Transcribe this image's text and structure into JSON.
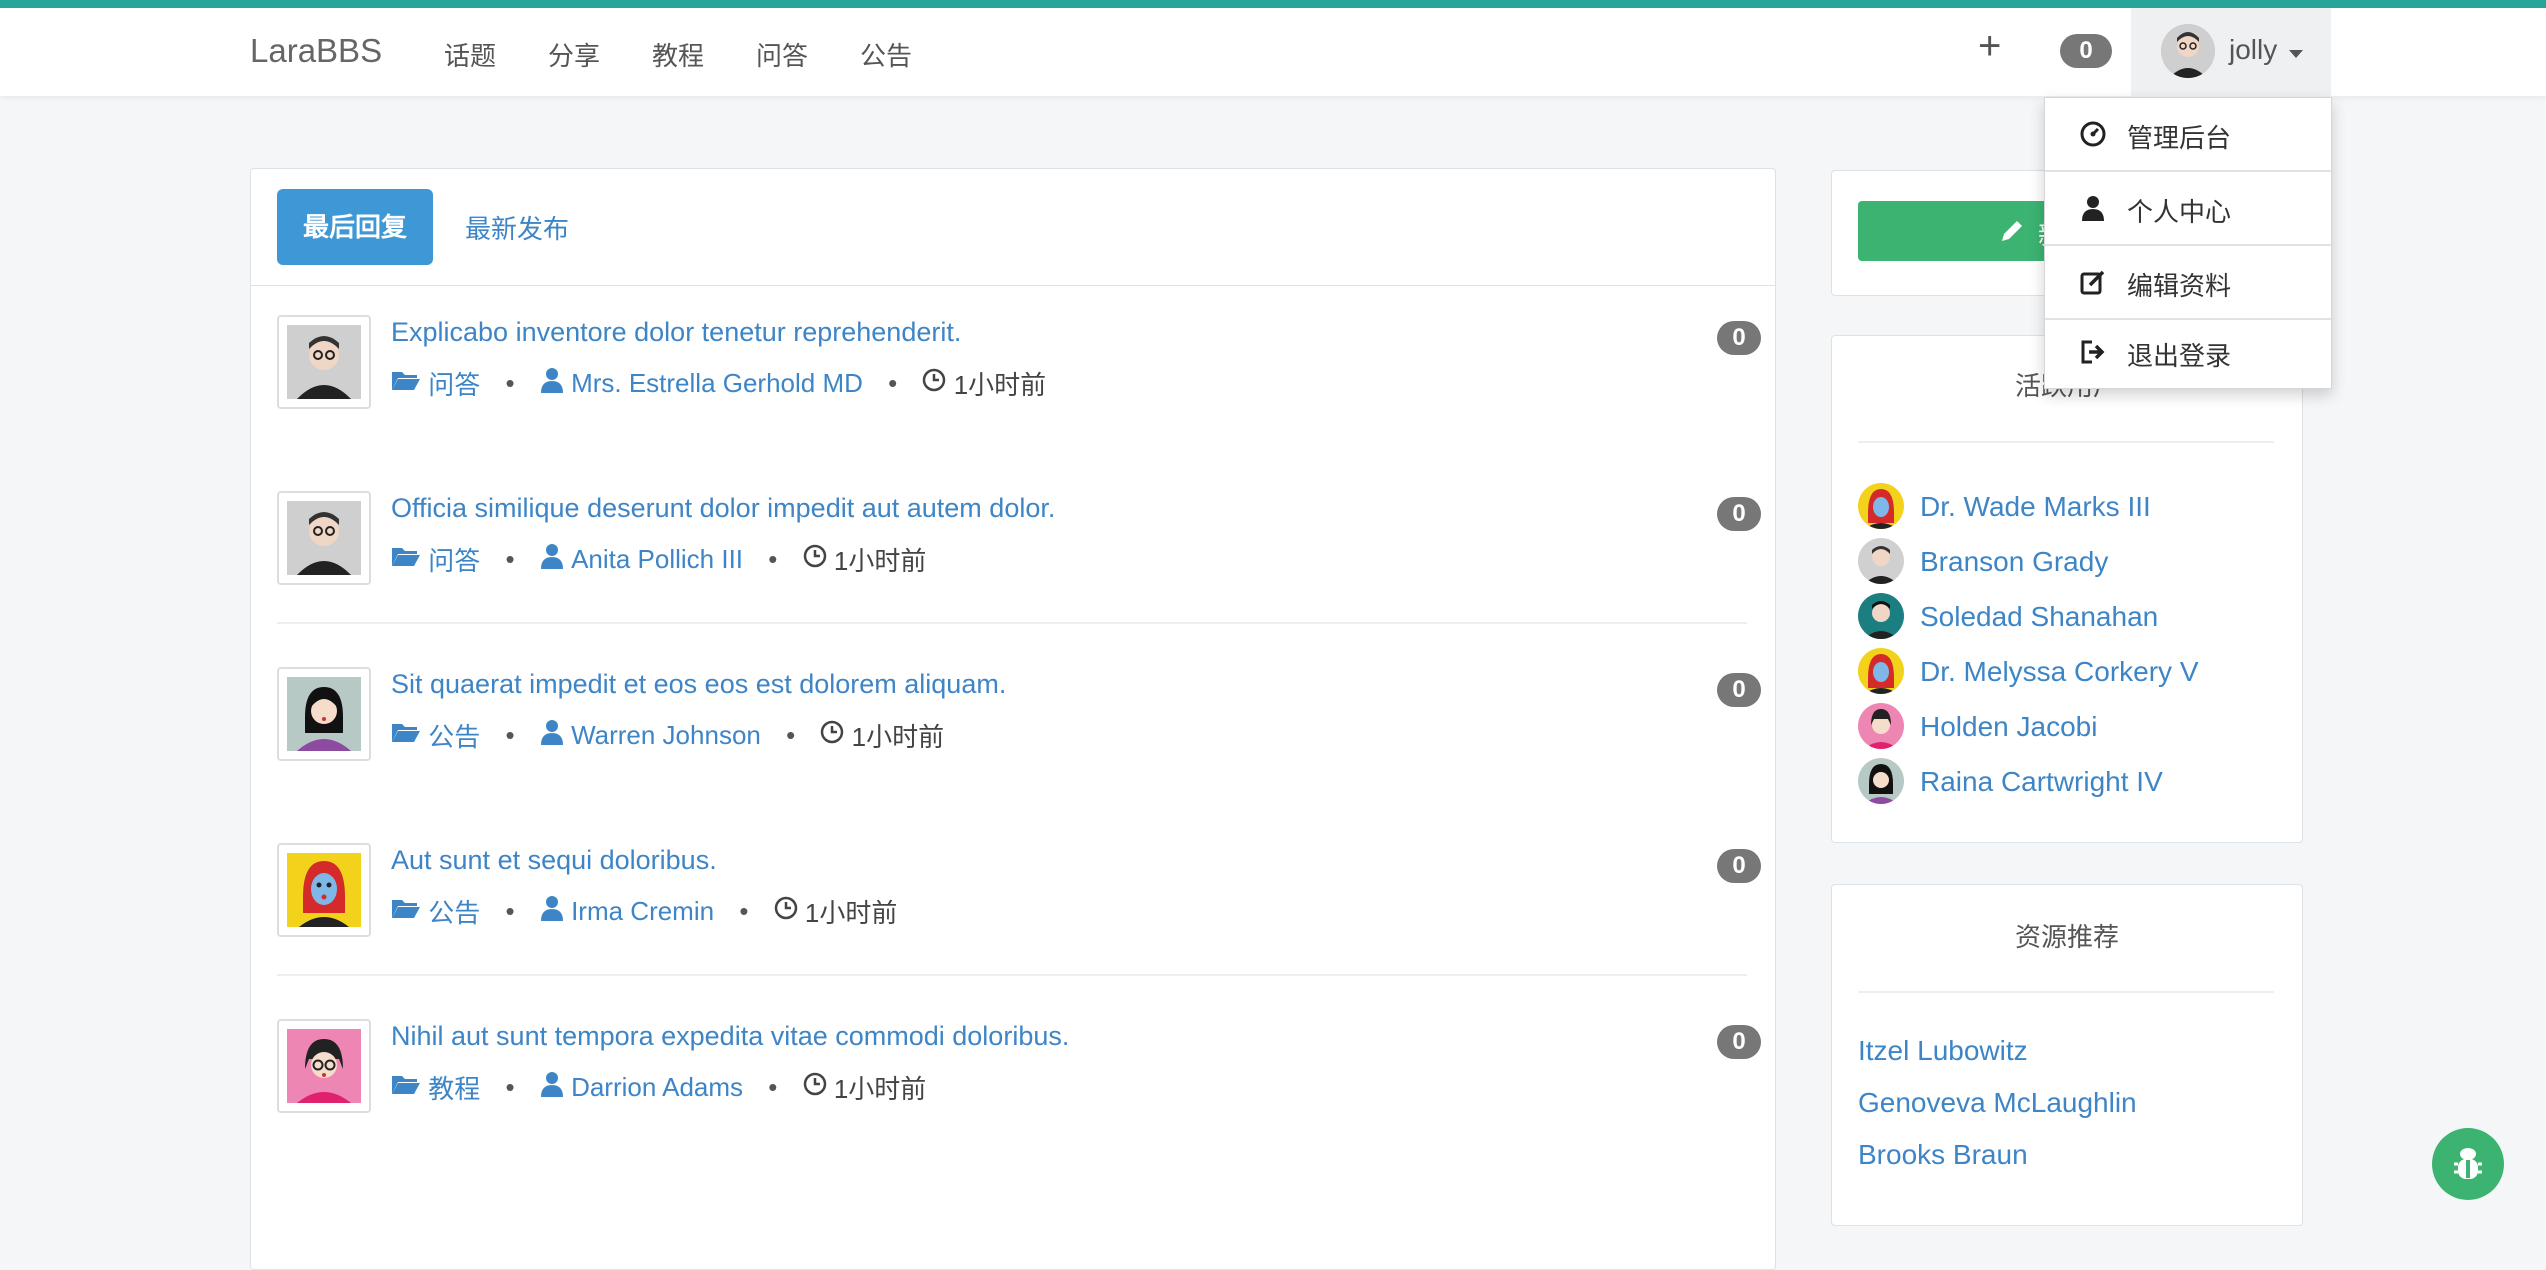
{
  "navbar": {
    "brand": "LaraBBS",
    "links": [
      "话题",
      "分享",
      "教程",
      "问答",
      "公告"
    ],
    "plus": "+",
    "notification_count": "0",
    "user_name": "jolly"
  },
  "user_menu": {
    "items": [
      {
        "label": "管理后台",
        "icon": "dashboard-icon"
      },
      {
        "label": "个人中心",
        "icon": "user-icon"
      },
      {
        "label": "编辑资料",
        "icon": "edit-icon"
      },
      {
        "label": "退出登录",
        "icon": "logout-icon"
      }
    ]
  },
  "tabs": {
    "active": "最后回复",
    "other": "最新发布"
  },
  "topics": [
    {
      "title": "Explicabo inventore dolor tenetur reprehenderit.",
      "category": "问答",
      "author": "Mrs. Estrella Gerhold MD",
      "time": "1小时前",
      "replies": "0",
      "avatar_color": "#cfcfcf"
    },
    {
      "title": "Officia similique deserunt dolor impedit aut autem dolor.",
      "category": "问答",
      "author": "Anita Pollich III",
      "time": "1小时前",
      "replies": "0",
      "avatar_color": "#cfcfcf"
    },
    {
      "title": "Sit quaerat impedit et eos eos est dolorem aliquam.",
      "category": "公告",
      "author": "Warren Johnson",
      "time": "1小时前",
      "replies": "0",
      "avatar_color": "#b7c9c5"
    },
    {
      "title": "Aut sunt et sequi doloribus.",
      "category": "公告",
      "author": "Irma Cremin",
      "time": "1小时前",
      "replies": "0",
      "avatar_color": "#f2d21b"
    },
    {
      "title": "Nihil aut sunt tempora expedita vitae commodi doloribus.",
      "category": "教程",
      "author": "Darrion Adams",
      "time": "1小时前",
      "replies": "0",
      "avatar_color": "#ee86b4"
    }
  ],
  "sidebar": {
    "new_topic_label": "新",
    "active_users_title": "活跃用户",
    "active_users": [
      {
        "name": "Dr. Wade Marks III",
        "color": "#f2d21b"
      },
      {
        "name": "Branson Grady",
        "color": "#d0d0d0"
      },
      {
        "name": "Soledad Shanahan",
        "color": "#1b7f82"
      },
      {
        "name": "Dr. Melyssa Corkery V",
        "color": "#f2d21b"
      },
      {
        "name": "Holden Jacobi",
        "color": "#ee86b4"
      },
      {
        "name": "Raina Cartwright IV",
        "color": "#b7c9c5"
      }
    ],
    "resources_title": "资源推荐",
    "resources": [
      "Itzel Lubowitz",
      "Genoveva McLaughlin",
      "Brooks Braun"
    ]
  }
}
